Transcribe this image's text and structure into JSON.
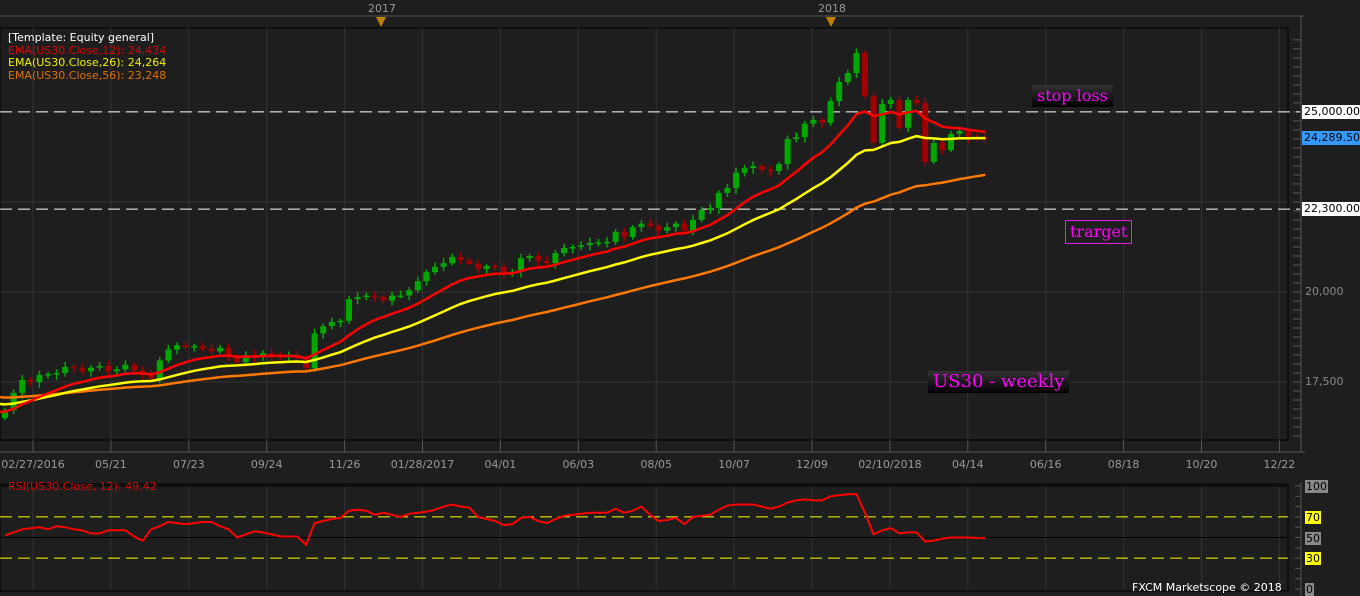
{
  "header": {
    "template_label": "[Template: Equity general]",
    "year_markers": [
      "2017",
      "2018"
    ]
  },
  "legend": [
    {
      "label": "EMA(US30.Close,12): 24,434",
      "color": "#e00000"
    },
    {
      "label": "EMA(US30.Close,26): 24,264",
      "color": "#f0f000"
    },
    {
      "label": "EMA(US30.Close,56): 23,248",
      "color": "#e07000"
    }
  ],
  "price_axis": {
    "labels": [
      {
        "text": "20,000",
        "value": 20000
      },
      {
        "text": "17,500",
        "value": 17500
      }
    ],
    "tags": [
      {
        "text": "25,000.00",
        "value": 25000,
        "bg": "#ffffff"
      },
      {
        "text": "24,289.50",
        "value": 24289.5,
        "bg": "#3399ff"
      },
      {
        "text": "22,300.00",
        "value": 22300,
        "bg": "#ffffff"
      }
    ]
  },
  "date_axis": [
    "02/27/2016",
    "05/21",
    "07/23",
    "09/24",
    "11/26",
    "01/28/2017",
    "04/01",
    "06/03",
    "08/05",
    "10/07",
    "12/09",
    "02/10/2018",
    "04/14",
    "06/16",
    "08/18",
    "10/20",
    "12/22"
  ],
  "annotations": {
    "stop_loss": "stop loss",
    "target": "trarget",
    "title": "US30 - weekly"
  },
  "rsi_panel": {
    "label": "RSI(US30.Close, 12): 49.42",
    "levels": [
      {
        "text": "100",
        "value": 100,
        "bg": "#888888"
      },
      {
        "text": "70",
        "value": 70,
        "bg": "#ffff00"
      },
      {
        "text": "50",
        "value": 50,
        "bg": "#888888"
      },
      {
        "text": "30",
        "value": 30,
        "bg": "#ffff00"
      },
      {
        "text": "0",
        "value": 0,
        "bg": "#888888"
      }
    ]
  },
  "footer": "FXCM Marketscope © 2018",
  "colors": {
    "up": "#00a800",
    "down": "#a00000",
    "ema12": "#ff0000",
    "ema26": "#ffff00",
    "ema56": "#ff7800",
    "rsi": "#ff0000",
    "bg": "#1e1e1e",
    "grid": "#333333"
  },
  "chart_data": {
    "type": "candlestick",
    "symbol": "US30",
    "timeframe": "weekly",
    "ylim": [
      15890,
      27330
    ],
    "hlines": [
      25000,
      22300
    ],
    "first_open": 16500,
    "closes": [
      16720,
      17200,
      17560,
      17500,
      17700,
      17720,
      17750,
      17920,
      17880,
      17800,
      17900,
      17950,
      17800,
      17850,
      17980,
      17820,
      17700,
      17600,
      18100,
      18400,
      18520,
      18470,
      18500,
      18420,
      18350,
      18450,
      18200,
      18050,
      18250,
      18200,
      18300,
      18260,
      18200,
      18240,
      18150,
      17880,
      18850,
      19050,
      19170,
      19200,
      19800,
      19860,
      19900,
      19870,
      19760,
      19900,
      19900,
      20050,
      20300,
      20550,
      20700,
      20800,
      20970,
      20890,
      20780,
      20640,
      20720,
      20700,
      20530,
      20560,
      20940,
      21000,
      20860,
      20800,
      21080,
      21220,
      21250,
      21300,
      21360,
      21380,
      21390,
      21670,
      21530,
      21800,
      21900,
      21830,
      21700,
      21800,
      21900,
      21700,
      22000,
      22280,
      22330,
      22750,
      22890,
      23310,
      23440,
      23500,
      23390,
      23360,
      23550,
      24250,
      24300,
      24670,
      24780,
      24700,
      25300,
      25830,
      26080,
      26640,
      25440,
      24140,
      25220,
      25330,
      24560,
      25330,
      25250,
      23610,
      24140,
      23940,
      24390,
      24470,
      24300,
      24290,
      24289.5
    ],
    "ema_seeds": {
      "ema12": 16670,
      "ema26": 16890,
      "ema56": 17080
    },
    "rsi": [
      52,
      55,
      58,
      59,
      60,
      58,
      61,
      60,
      58,
      57,
      54,
      54,
      57,
      57,
      57,
      51,
      47,
      58,
      61,
      65,
      64,
      63,
      64,
      65,
      65,
      61,
      58,
      50,
      53,
      56,
      55,
      53,
      51,
      51,
      51,
      43,
      64,
      66,
      68,
      69,
      76,
      77,
      76,
      72,
      74,
      72,
      70,
      73,
      74,
      75,
      77,
      80,
      82,
      80,
      79,
      70,
      68,
      66,
      62,
      63,
      69,
      70,
      66,
      64,
      68,
      71,
      72,
      73,
      74,
      74,
      74,
      78,
      74,
      76,
      80,
      72,
      66,
      67,
      69,
      63,
      70,
      71,
      72,
      77,
      81,
      82,
      82,
      82,
      80,
      78,
      80,
      84,
      86,
      87,
      86,
      86,
      90,
      91,
      92,
      92,
      74,
      53,
      57,
      59,
      54,
      55,
      55,
      46,
      47,
      49,
      50,
      50,
      50,
      49.5,
      49.42
    ],
    "rsi_ylim": [
      0,
      100
    ],
    "rsi_levels": [
      70,
      50,
      30
    ]
  }
}
